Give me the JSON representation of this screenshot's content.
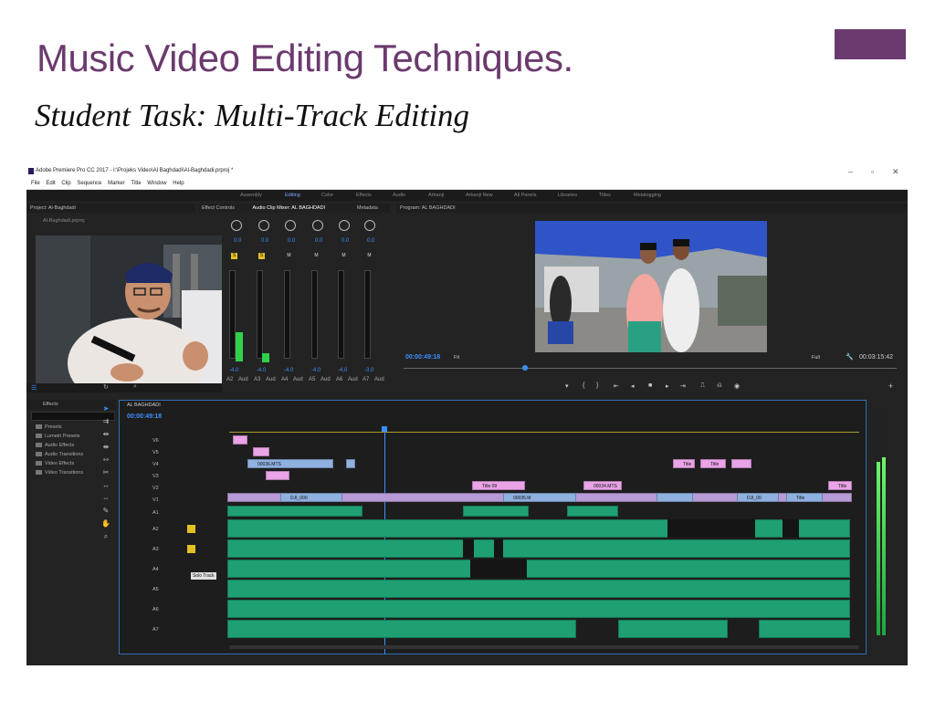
{
  "slide": {
    "title": "Music Video Editing Techniques.",
    "subtitle": "Student Task:  Multi-Track Editing",
    "accent_color": "#6b3a6e"
  },
  "window": {
    "title": "Adobe Premiere Pro CC 2017 - I:\\Projeks Video\\Al Baghdadi\\Al-Baghdadi.prproj *",
    "controls": [
      "–",
      "▫",
      "✕"
    ],
    "menu": [
      "File",
      "Edit",
      "Clip",
      "Sequence",
      "Marker",
      "Title",
      "Window",
      "Help"
    ],
    "workspaces": [
      "Assembly",
      "Editing",
      "Color",
      "Effects",
      "Audio",
      "Arbanji",
      "Arbanji New",
      "All Panels",
      "Libraries",
      "Titles",
      "Metalogging"
    ],
    "active_workspace": "Editing"
  },
  "panels": {
    "project_tab": "Project: Al-Baghdadi",
    "project_file": "Al-Baghdadi.prproj",
    "effect_controls_tab": "Effect Controls",
    "mixer_tab": "Audio Clip Mixer: AL BAGHDADI",
    "metadata_tab": "Metadata",
    "program_tab": "Program: AL BAGHDADI",
    "program_timecode": "00:00:49:18",
    "program_fit": "Fit",
    "program_full": "Full",
    "program_duration": "00:03:15:42",
    "mixer_values": [
      "0.0",
      "0.0",
      "0.0",
      "0.0",
      "0.0",
      "0.0"
    ],
    "mixer_channels": [
      "A2",
      "Aud",
      "A3",
      "Aud",
      "A4",
      "Aud",
      "A5",
      "Aud",
      "A6",
      "Aud",
      "A7",
      "Aud"
    ],
    "mixer_db": [
      "-4.0",
      "-4.0",
      "-4.0",
      "-4.0",
      "-4.0",
      "-3.0"
    ]
  },
  "effects_panel": {
    "tab": "Effects",
    "items": [
      "Presets",
      "Lumetri Presets",
      "Audio Effects",
      "Audio Transitions",
      "Video Effects",
      "Video Transitions"
    ]
  },
  "timeline": {
    "sequence_tab": "AL BAGHDADI",
    "timecode": "00:00:49:18",
    "video_tracks": [
      "V6",
      "V5",
      "V4",
      "V3",
      "V2",
      "V1"
    ],
    "audio_tracks": [
      "A1",
      "A2",
      "A3",
      "A4",
      "A5",
      "A6",
      "A7"
    ],
    "tooltip": "Solo Track",
    "clip_labels": [
      "00036.MTS",
      "Title",
      "Title",
      "Title 09",
      "00034.MTS",
      "00035.M",
      "DJI_000",
      "DJI_00",
      "Title",
      "Title"
    ]
  }
}
